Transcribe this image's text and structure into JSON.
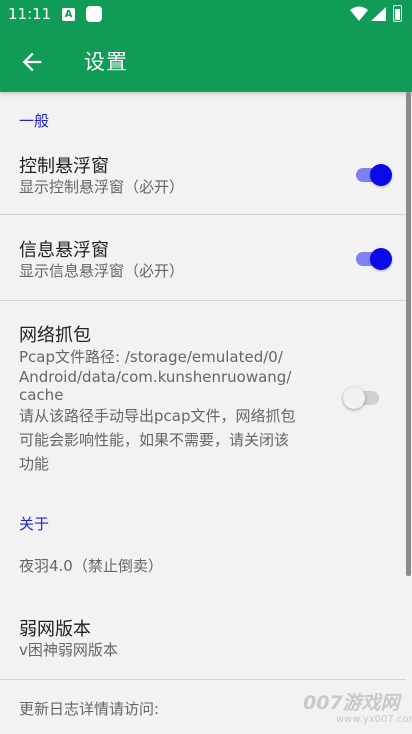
{
  "status_bar": {
    "time": "11:11",
    "notification_letter": "A",
    "icons": [
      "notification-a-icon",
      "notification-square-icon",
      "wifi-icon",
      "signal-icon",
      "battery-icon"
    ]
  },
  "app_bar": {
    "title": "设置",
    "back_icon": "arrow-left-icon",
    "color": "#109b56"
  },
  "sections": {
    "general": {
      "header": "一般"
    },
    "about": {
      "header": "关于"
    }
  },
  "prefs": {
    "control_float": {
      "title": "控制悬浮窗",
      "summary": "显示控制悬浮窗（必开）",
      "enabled": true
    },
    "info_float": {
      "title": "信息悬浮窗",
      "summary": "显示信息悬浮窗（必开）",
      "enabled": true
    },
    "capture": {
      "title": "网络抓包",
      "summary_lines": [
        "Pcap文件路径: /storage/emulated/0/",
        "Android/data/com.kunshenruowang/",
        "cache",
        "请从该路径手动导出pcap文件，网络抓包",
        "可能会影响性能，如果不需要，请关闭该",
        "功能"
      ],
      "enabled": false
    },
    "version_author": {
      "summary": "夜羽4.0（禁止倒卖）"
    },
    "weak_net_version": {
      "title": "弱网版本",
      "summary": "v困神弱网版本"
    },
    "changelog": {
      "summary": "更新日志详情请访问:"
    }
  },
  "watermark": {
    "text": "007游戏网",
    "url": "www.yx007.com"
  },
  "colors": {
    "accent": "#0a0ae6",
    "section_header": "#2222cc",
    "primary": "#109b56"
  }
}
